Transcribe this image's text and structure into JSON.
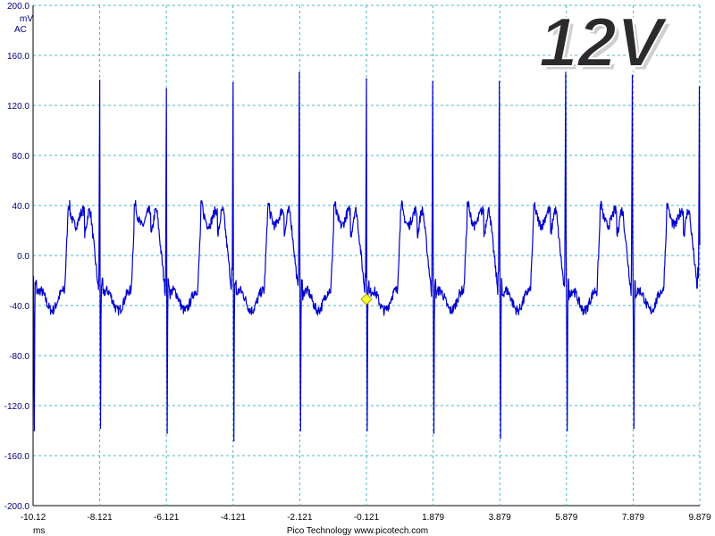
{
  "chart_data": {
    "type": "line",
    "title": "12V",
    "ylabel": "mV",
    "ycoupling": "AC",
    "xlabel": "ms",
    "ylim": [
      -200,
      200
    ],
    "xlim": [
      -10.12,
      9.879
    ],
    "yticks": [
      "200.0",
      "160.0",
      "120.0",
      "80.0",
      "40.0",
      "0.0",
      "-40.0",
      "-80.0",
      "-120.0",
      "-160.0",
      "-200.0"
    ],
    "xticks": [
      "-10.12",
      "-8.121",
      "-6.121",
      "-4.121",
      "-2.121",
      "-0.121",
      "1.879",
      "3.879",
      "5.879",
      "7.879",
      "9.879"
    ],
    "grid": true,
    "trigger_marker": {
      "x": -0.121,
      "y": -35
    },
    "series": [
      {
        "color": "#0000cc",
        "period_ms": 1.996,
        "pos_spike_x": [
          -8.12,
          -6.12,
          -4.12,
          -2.13,
          -0.12,
          1.87,
          3.87,
          5.86,
          7.86,
          9.87
        ],
        "pos_spike_y": [
          140,
          133,
          138,
          146,
          141,
          139,
          139,
          147,
          144,
          135
        ],
        "neg_spike_x": [
          -10.08,
          -8.1,
          -6.1,
          -4.1,
          -2.1,
          -0.1,
          1.9,
          3.9,
          5.9,
          7.9
        ],
        "neg_spike_y": [
          -140,
          -138,
          -142,
          -148,
          -140,
          -140,
          -142,
          -146,
          -140,
          -138
        ],
        "plateau_mV": 30,
        "trough_mV": -32,
        "noise_mV": 4
      }
    ]
  },
  "footer": {
    "brand": "Pico Technology   www.picotech.com"
  }
}
